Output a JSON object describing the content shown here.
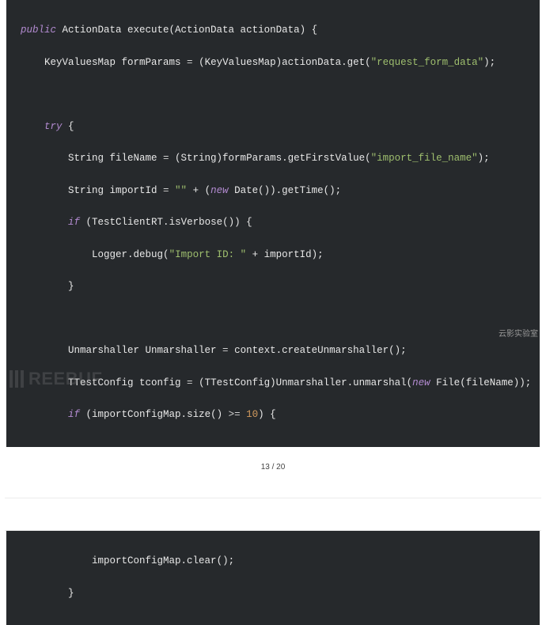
{
  "code_top": {
    "l1": {
      "kw": "public",
      "t1": " ActionData ",
      "fn": "execute",
      "t2": "(ActionData actionData) {"
    },
    "l2": {
      "t1": "    KeyValuesMap formParams ",
      "op": "=",
      "t2": " (KeyValuesMap)actionData.",
      "fn": "get",
      "p1": "(",
      "s1": "\"request_form_data\"",
      "p2": ");"
    },
    "l3": "",
    "l4": {
      "t0": "    ",
      "kw": "try",
      "t1": " {"
    },
    "l5": {
      "t1": "        String fileName ",
      "op": "=",
      "t2": " (String)formParams.",
      "fn": "getFirstValue",
      "p1": "(",
      "s1": "\"import_file_name\"",
      "p2": ");"
    },
    "l6": {
      "t1": "        String importId ",
      "op": "=",
      "s0": " \"\"",
      "t2": " + (",
      "kw": "new",
      "t3": " ",
      "fn": "Date",
      "p1": "()).",
      "fn2": "getTime",
      "p2": "();"
    },
    "l7": {
      "t0": "        ",
      "kw": "if",
      "t1": " (TestClientRT.",
      "fn": "isVerbose",
      "p1": "()) {"
    },
    "l8": {
      "t1": "            Logger.",
      "fn": "debug",
      "p1": "(",
      "s1": "\"Import ID: \"",
      "t2": " + importId);"
    },
    "l9": "        }",
    "l10": "",
    "l11": {
      "t1": "        Unmarshaller Unmarshaller ",
      "op": "=",
      "t2": " context.",
      "fn": "createUnmarshaller",
      "p1": "();"
    },
    "l12": {
      "t1": "        TTestConfig tconfig ",
      "op": "=",
      "t2": " (TTestConfig)Unmarshaller.",
      "fn": "unmarshal",
      "p1": "(",
      "kw": "new",
      "t3": " ",
      "fn2": "File",
      "p2": "(fileName));"
    },
    "l13": {
      "t0": "        ",
      "kw": "if",
      "t1": " (importConfigMap.",
      "fn": "size",
      "p1": "() ",
      "op": ">=",
      "n1": " 10",
      "p2": ") {"
    }
  },
  "pager": {
    "text": "13 / 20"
  },
  "watermark_label": "云影实验室",
  "watermark_logo": "REEBUF",
  "code_bottom": {
    "l1": {
      "t1": "            importConfigMap.",
      "fn": "clear",
      "p1": "();"
    },
    "l2": "        }"
  }
}
